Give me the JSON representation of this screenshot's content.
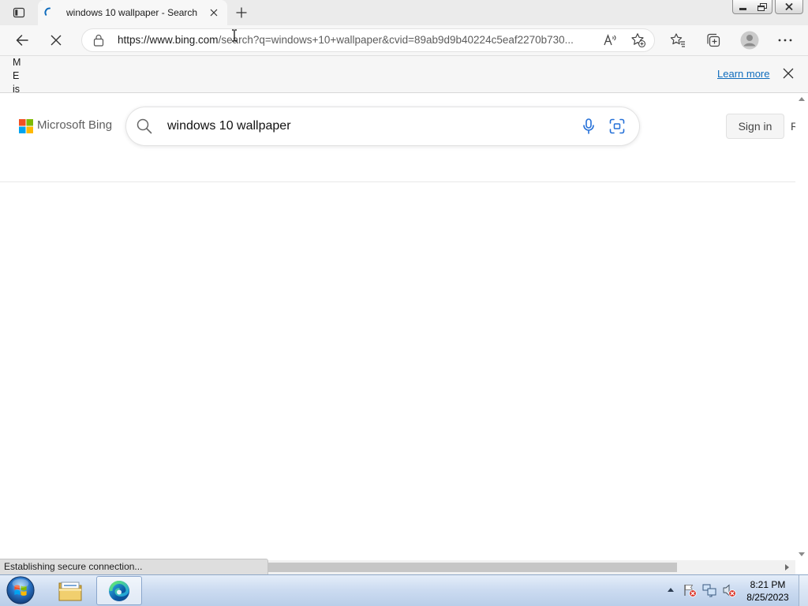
{
  "browser": {
    "tab_title": "windows 10 wallpaper - Search",
    "url_host": "https://www.bing.com",
    "url_path": "/search?q=windows+10+wallpaper&cvid=89ab9d9b40224c5eaf2270b730...",
    "icons": {
      "tab_actions": "tab-actions-icon",
      "tab_loading": "loading-spinner-icon",
      "new_tab": "plus-icon",
      "back": "back-arrow-icon",
      "stop": "stop-icon",
      "site_info": "lock-icon",
      "read_aloud": "read-aloud-icon",
      "add_favorite": "add-favorite-icon",
      "favorites": "favorites-icon",
      "collections": "collections-icon",
      "profile": "profile-icon",
      "more": "more-icon"
    }
  },
  "infobar": {
    "lines": [
      "M",
      "E",
      "is"
    ],
    "learn_more": "Learn more"
  },
  "bing": {
    "brand": "Microsoft Bing",
    "query": "windows 10 wallpaper",
    "sign_in": "Sign in",
    "rewards_partial": "R"
  },
  "status_bar": {
    "text": "Establishing secure connection..."
  },
  "taskbar": {
    "time": "8:21 PM",
    "date": "8/25/2023",
    "icons": {
      "start": "windows-start-icon",
      "explorer": "file-explorer-icon",
      "edge": "edge-icon",
      "tray": [
        "action-center-flag-icon",
        "network-icon",
        "volume-muted-icon"
      ]
    }
  },
  "colors": {
    "accent": "#0f6cbd",
    "bing_logo": [
      "#f25022",
      "#7fba00",
      "#00a4ef",
      "#ffb900"
    ],
    "search_actions": "#2470d8",
    "taskbar": "#c9daf0"
  }
}
